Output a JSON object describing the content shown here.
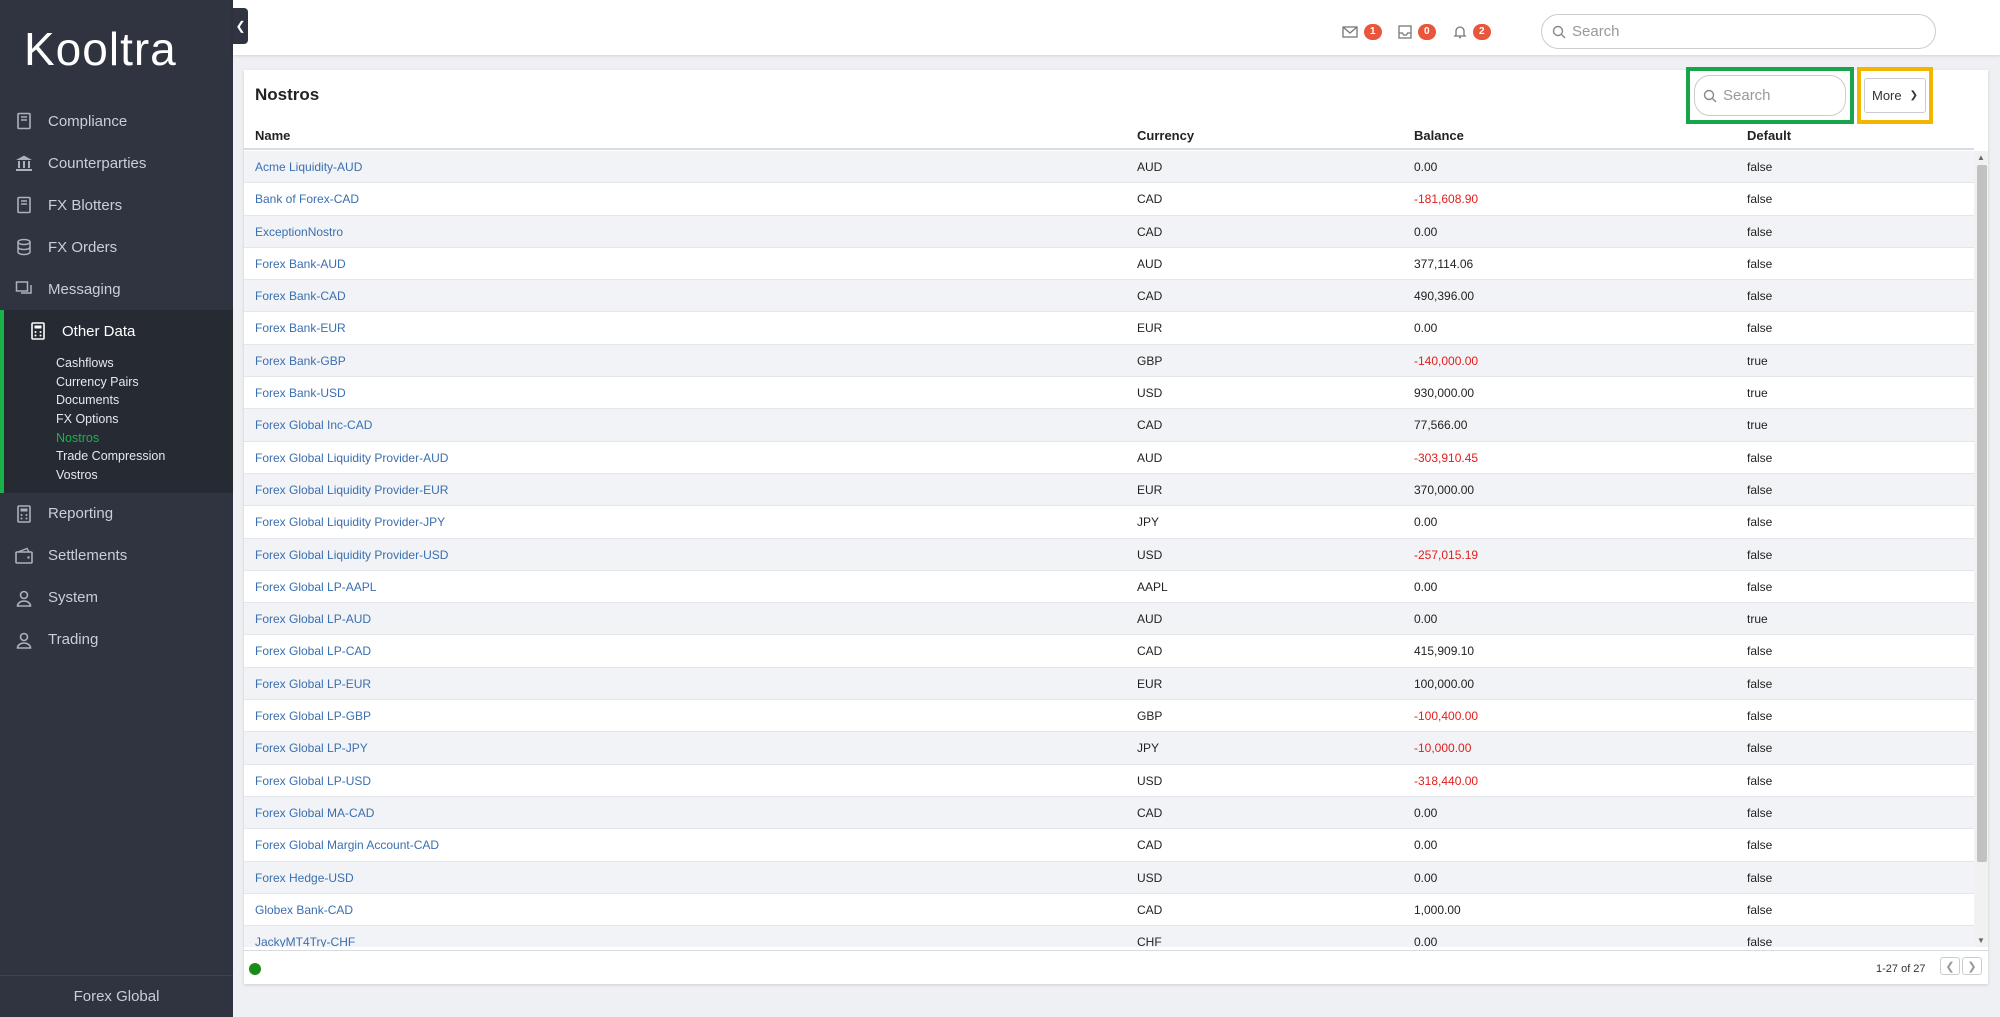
{
  "brand": {
    "logo": "Kooltra"
  },
  "sidebar": {
    "items_top": [
      {
        "label": "Compliance",
        "icon": "book-icon"
      },
      {
        "label": "Counterparties",
        "icon": "bank-icon"
      },
      {
        "label": "FX Blotters",
        "icon": "book-icon"
      },
      {
        "label": "FX Orders",
        "icon": "database-icon"
      },
      {
        "label": "Messaging",
        "icon": "messages-icon"
      }
    ],
    "active_item": {
      "label": "Other Data",
      "icon": "calculator-icon"
    },
    "sub_items": [
      "Cashflows",
      "Currency Pairs",
      "Documents",
      "FX Options",
      "Nostros",
      "Trade Compression",
      "Vostros"
    ],
    "current_sub": "Nostros",
    "items_bottom": [
      {
        "label": "Reporting",
        "icon": "calculator-icon"
      },
      {
        "label": "Settlements",
        "icon": "wallet-icon"
      },
      {
        "label": "System",
        "icon": "user-icon"
      },
      {
        "label": "Trading",
        "icon": "user-icon"
      }
    ],
    "footer": "Forex Global"
  },
  "topbar": {
    "mail_count": "1",
    "inbox_count": "0",
    "bell_count": "2",
    "search_placeholder": "Search"
  },
  "panel": {
    "title": "Nostros",
    "search_placeholder": "Search",
    "more_label": "More",
    "columns": {
      "name": "Name",
      "currency": "Currency",
      "balance": "Balance",
      "default": "Default"
    },
    "rows": [
      {
        "name": "Acme Liquidity-AUD",
        "currency": "AUD",
        "balance": "0.00",
        "default": "false"
      },
      {
        "name": "Bank of Forex-CAD",
        "currency": "CAD",
        "balance": "-181,608.90",
        "default": "false"
      },
      {
        "name": "ExceptionNostro",
        "currency": "CAD",
        "balance": "0.00",
        "default": "false"
      },
      {
        "name": "Forex Bank-AUD",
        "currency": "AUD",
        "balance": "377,114.06",
        "default": "false"
      },
      {
        "name": "Forex Bank-CAD",
        "currency": "CAD",
        "balance": "490,396.00",
        "default": "false"
      },
      {
        "name": "Forex Bank-EUR",
        "currency": "EUR",
        "balance": "0.00",
        "default": "false"
      },
      {
        "name": "Forex Bank-GBP",
        "currency": "GBP",
        "balance": "-140,000.00",
        "default": "true"
      },
      {
        "name": "Forex Bank-USD",
        "currency": "USD",
        "balance": "930,000.00",
        "default": "true"
      },
      {
        "name": "Forex Global Inc-CAD",
        "currency": "CAD",
        "balance": "77,566.00",
        "default": "true"
      },
      {
        "name": "Forex Global Liquidity Provider-AUD",
        "currency": "AUD",
        "balance": "-303,910.45",
        "default": "false"
      },
      {
        "name": "Forex Global Liquidity Provider-EUR",
        "currency": "EUR",
        "balance": "370,000.00",
        "default": "false"
      },
      {
        "name": "Forex Global Liquidity Provider-JPY",
        "currency": "JPY",
        "balance": "0.00",
        "default": "false"
      },
      {
        "name": "Forex Global Liquidity Provider-USD",
        "currency": "USD",
        "balance": "-257,015.19",
        "default": "false"
      },
      {
        "name": "Forex Global LP-AAPL",
        "currency": "AAPL",
        "balance": "0.00",
        "default": "false"
      },
      {
        "name": "Forex Global LP-AUD",
        "currency": "AUD",
        "balance": "0.00",
        "default": "true"
      },
      {
        "name": "Forex Global LP-CAD",
        "currency": "CAD",
        "balance": "415,909.10",
        "default": "false"
      },
      {
        "name": "Forex Global LP-EUR",
        "currency": "EUR",
        "balance": "100,000.00",
        "default": "false"
      },
      {
        "name": "Forex Global LP-GBP",
        "currency": "GBP",
        "balance": "-100,400.00",
        "default": "false"
      },
      {
        "name": "Forex Global LP-JPY",
        "currency": "JPY",
        "balance": "-10,000.00",
        "default": "false"
      },
      {
        "name": "Forex Global LP-USD",
        "currency": "USD",
        "balance": "-318,440.00",
        "default": "false"
      },
      {
        "name": "Forex Global MA-CAD",
        "currency": "CAD",
        "balance": "0.00",
        "default": "false"
      },
      {
        "name": "Forex Global Margin Account-CAD",
        "currency": "CAD",
        "balance": "0.00",
        "default": "false"
      },
      {
        "name": "Forex Hedge-USD",
        "currency": "USD",
        "balance": "0.00",
        "default": "false"
      },
      {
        "name": "Globex Bank-CAD",
        "currency": "CAD",
        "balance": "1,000.00",
        "default": "false"
      },
      {
        "name": "JackyMT4Try-CHF",
        "currency": "CHF",
        "balance": "0.00",
        "default": "false"
      }
    ],
    "pager": "1-27 of 27",
    "negative_color": "#e0201c",
    "status_color": "#1a8a1a"
  }
}
